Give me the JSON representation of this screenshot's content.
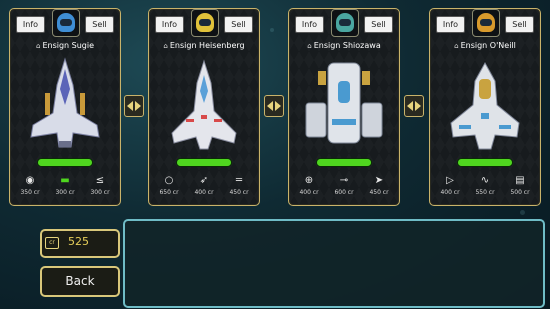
{
  "cards": [
    {
      "pilot": "Ensign Sugie",
      "info_label": "Info",
      "sell_label": "Sell",
      "helmet_color": "#3f8ed4",
      "ship": "interceptor",
      "health_fraction": 1.0,
      "slots": [
        {
          "icon": "shield-icon",
          "price": "350 cr"
        },
        {
          "icon": "battery-icon",
          "price": "300 cr"
        },
        {
          "icon": "spread-shot-icon",
          "price": "300 cr"
        }
      ]
    },
    {
      "pilot": "Ensign Heisenberg",
      "info_label": "Info",
      "sell_label": "Sell",
      "helmet_color": "#e0c23a",
      "ship": "fighter",
      "health_fraction": 1.0,
      "slots": [
        {
          "icon": "ring-icon",
          "price": "650 cr"
        },
        {
          "icon": "rocket-icon",
          "price": "400 cr"
        },
        {
          "icon": "cannon-icon",
          "price": "450 cr"
        }
      ]
    },
    {
      "pilot": "Ensign Shiozawa",
      "info_label": "Info",
      "sell_label": "Sell",
      "helmet_color": "#4aa6a0",
      "ship": "heavy",
      "health_fraction": 1.0,
      "slots": [
        {
          "icon": "crosshair-icon",
          "price": "400 cr"
        },
        {
          "icon": "rifle-icon",
          "price": "600 cr"
        },
        {
          "icon": "missile-icon",
          "price": "450 cr"
        }
      ]
    },
    {
      "pilot": "Ensign O'Neill",
      "info_label": "Info",
      "sell_label": "Sell",
      "helmet_color": "#d89a2c",
      "ship": "gunship",
      "health_fraction": 1.0,
      "slots": [
        {
          "icon": "play-icon",
          "price": "400 cr"
        },
        {
          "icon": "wave-icon",
          "price": "550 cr"
        },
        {
          "icon": "ammo-icon",
          "price": "500 cr"
        }
      ]
    }
  ],
  "credits": {
    "value": "525"
  },
  "back_label": "Back",
  "colors": {
    "card_border": "#c9b36a",
    "health": "#4fd61f",
    "credits_text": "#e6cf5a",
    "panel_border": "#6fbcc6"
  }
}
